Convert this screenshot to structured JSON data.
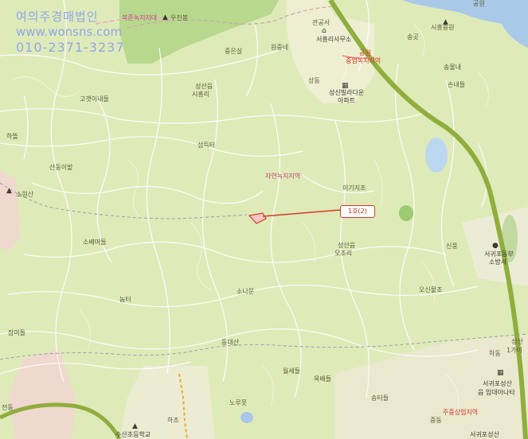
{
  "watermark": {
    "name": "여의주경매법인",
    "website": "www.wonsns.com",
    "phone": "010-2371-3237"
  },
  "marker": {
    "label": "1호(2)"
  },
  "labels": {
    "top_left_pink": "북준녹지지대",
    "bonsan": "우진봉",
    "junggeum": "중은실",
    "wolsan": "원중네",
    "office": "서흥리사무소",
    "songgol": "송곳",
    "seinjungwon": "시흥중원",
    "upper_pink": "공원",
    "commerce_green": "중업녹지지역",
    "sangdong": "상동",
    "seongsin_apt1": "성신빌라다운",
    "seongsin_apt2": "아파트",
    "songmul": "송물내",
    "sonnet": "손내들",
    "seongsaneup1": "성산읍",
    "seongsaneup2": "시흥리",
    "gogaenae": "고갯이내들",
    "haktteul": "하뜰",
    "semdeuk": "섬득터",
    "sandongibat": "산동이밭",
    "jayeon_green": "자연녹지지역",
    "igi": "이기지조",
    "soyeolsan": "소원산",
    "somaeteul": "소배머들",
    "sinpung": "신풍",
    "seongsan_so1": "성산읍",
    "seongsan_so2": "오조리",
    "noteul": "놈터",
    "sooryun": "소나문",
    "osingok": "오신물초",
    "jaeteul": "잠머들",
    "dongdaesan": "동대산",
    "okbyeong": "옥배들",
    "wolsejeon": "월세들",
    "sottleul": "송터들",
    "right_sangsan": "성산",
    "right_1ga": "1가이",
    "hadong": "하동",
    "seogwipo1": "서귀포성산",
    "seogwipo2": "읍 입대아나타",
    "norutgol": "노루못",
    "hajo": "하조",
    "right_commerce": "주중상업지역",
    "jungdong": "중동",
    "bottom_school": "수산초등학교",
    "bottom_right": "서귀포성산",
    "bottom_left": "전동",
    "top_right": "공원",
    "right_school1": "서귀포동부",
    "right_school2": "소방서",
    "top_center_mark": "관공서"
  }
}
